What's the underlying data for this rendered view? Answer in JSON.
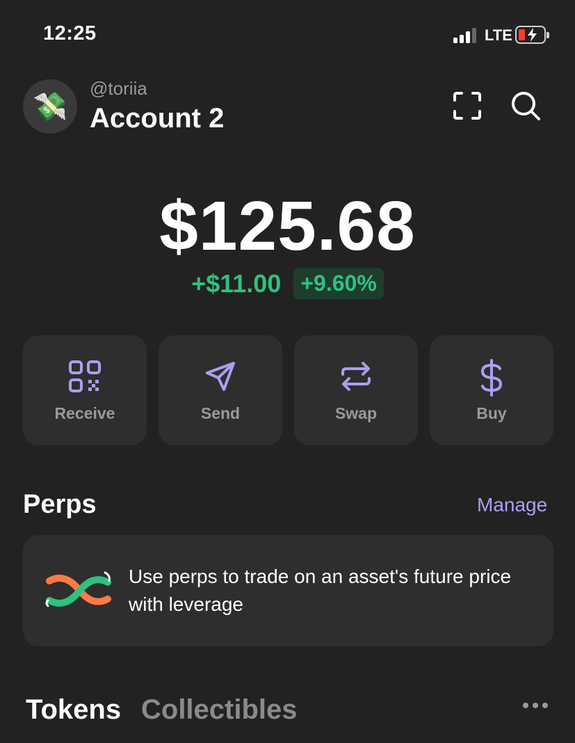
{
  "status_bar": {
    "time": "12:25",
    "network": "LTE",
    "battery_color": "#ff3b30"
  },
  "header": {
    "avatar_icon": "money-with-wings-icon",
    "avatar_emoji": "💸",
    "handle": "@toriia",
    "account_name": "Account 2"
  },
  "balance": {
    "total": "$125.68",
    "change_amount": "+$11.00",
    "change_percent": "+9.60%",
    "positive_color": "#2ec27e"
  },
  "actions": [
    {
      "label": "Receive",
      "icon": "qr-code-icon"
    },
    {
      "label": "Send",
      "icon": "paper-plane-icon"
    },
    {
      "label": "Swap",
      "icon": "swap-arrows-icon"
    },
    {
      "label": "Buy",
      "icon": "dollar-icon"
    }
  ],
  "accent_color": "#ab9ff2",
  "perps": {
    "title": "Perps",
    "manage_label": "Manage",
    "description": "Use perps to trade on an asset's future price with leverage"
  },
  "tabs": {
    "tokens": "Tokens",
    "collectibles": "Collectibles"
  }
}
